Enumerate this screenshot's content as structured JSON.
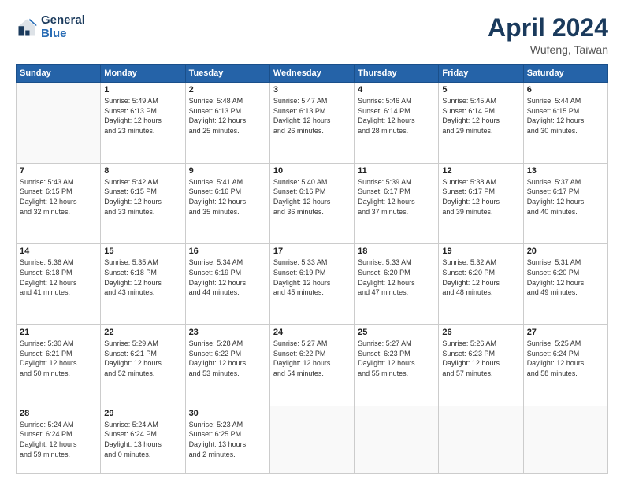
{
  "header": {
    "logo_line1": "General",
    "logo_line2": "Blue",
    "month": "April 2024",
    "location": "Wufeng, Taiwan"
  },
  "weekdays": [
    "Sunday",
    "Monday",
    "Tuesday",
    "Wednesday",
    "Thursday",
    "Friday",
    "Saturday"
  ],
  "weeks": [
    [
      {
        "day": "",
        "info": ""
      },
      {
        "day": "1",
        "info": "Sunrise: 5:49 AM\nSunset: 6:13 PM\nDaylight: 12 hours\nand 23 minutes."
      },
      {
        "day": "2",
        "info": "Sunrise: 5:48 AM\nSunset: 6:13 PM\nDaylight: 12 hours\nand 25 minutes."
      },
      {
        "day": "3",
        "info": "Sunrise: 5:47 AM\nSunset: 6:13 PM\nDaylight: 12 hours\nand 26 minutes."
      },
      {
        "day": "4",
        "info": "Sunrise: 5:46 AM\nSunset: 6:14 PM\nDaylight: 12 hours\nand 28 minutes."
      },
      {
        "day": "5",
        "info": "Sunrise: 5:45 AM\nSunset: 6:14 PM\nDaylight: 12 hours\nand 29 minutes."
      },
      {
        "day": "6",
        "info": "Sunrise: 5:44 AM\nSunset: 6:15 PM\nDaylight: 12 hours\nand 30 minutes."
      }
    ],
    [
      {
        "day": "7",
        "info": "Sunrise: 5:43 AM\nSunset: 6:15 PM\nDaylight: 12 hours\nand 32 minutes."
      },
      {
        "day": "8",
        "info": "Sunrise: 5:42 AM\nSunset: 6:15 PM\nDaylight: 12 hours\nand 33 minutes."
      },
      {
        "day": "9",
        "info": "Sunrise: 5:41 AM\nSunset: 6:16 PM\nDaylight: 12 hours\nand 35 minutes."
      },
      {
        "day": "10",
        "info": "Sunrise: 5:40 AM\nSunset: 6:16 PM\nDaylight: 12 hours\nand 36 minutes."
      },
      {
        "day": "11",
        "info": "Sunrise: 5:39 AM\nSunset: 6:17 PM\nDaylight: 12 hours\nand 37 minutes."
      },
      {
        "day": "12",
        "info": "Sunrise: 5:38 AM\nSunset: 6:17 PM\nDaylight: 12 hours\nand 39 minutes."
      },
      {
        "day": "13",
        "info": "Sunrise: 5:37 AM\nSunset: 6:17 PM\nDaylight: 12 hours\nand 40 minutes."
      }
    ],
    [
      {
        "day": "14",
        "info": "Sunrise: 5:36 AM\nSunset: 6:18 PM\nDaylight: 12 hours\nand 41 minutes."
      },
      {
        "day": "15",
        "info": "Sunrise: 5:35 AM\nSunset: 6:18 PM\nDaylight: 12 hours\nand 43 minutes."
      },
      {
        "day": "16",
        "info": "Sunrise: 5:34 AM\nSunset: 6:19 PM\nDaylight: 12 hours\nand 44 minutes."
      },
      {
        "day": "17",
        "info": "Sunrise: 5:33 AM\nSunset: 6:19 PM\nDaylight: 12 hours\nand 45 minutes."
      },
      {
        "day": "18",
        "info": "Sunrise: 5:33 AM\nSunset: 6:20 PM\nDaylight: 12 hours\nand 47 minutes."
      },
      {
        "day": "19",
        "info": "Sunrise: 5:32 AM\nSunset: 6:20 PM\nDaylight: 12 hours\nand 48 minutes."
      },
      {
        "day": "20",
        "info": "Sunrise: 5:31 AM\nSunset: 6:20 PM\nDaylight: 12 hours\nand 49 minutes."
      }
    ],
    [
      {
        "day": "21",
        "info": "Sunrise: 5:30 AM\nSunset: 6:21 PM\nDaylight: 12 hours\nand 50 minutes."
      },
      {
        "day": "22",
        "info": "Sunrise: 5:29 AM\nSunset: 6:21 PM\nDaylight: 12 hours\nand 52 minutes."
      },
      {
        "day": "23",
        "info": "Sunrise: 5:28 AM\nSunset: 6:22 PM\nDaylight: 12 hours\nand 53 minutes."
      },
      {
        "day": "24",
        "info": "Sunrise: 5:27 AM\nSunset: 6:22 PM\nDaylight: 12 hours\nand 54 minutes."
      },
      {
        "day": "25",
        "info": "Sunrise: 5:27 AM\nSunset: 6:23 PM\nDaylight: 12 hours\nand 55 minutes."
      },
      {
        "day": "26",
        "info": "Sunrise: 5:26 AM\nSunset: 6:23 PM\nDaylight: 12 hours\nand 57 minutes."
      },
      {
        "day": "27",
        "info": "Sunrise: 5:25 AM\nSunset: 6:24 PM\nDaylight: 12 hours\nand 58 minutes."
      }
    ],
    [
      {
        "day": "28",
        "info": "Sunrise: 5:24 AM\nSunset: 6:24 PM\nDaylight: 12 hours\nand 59 minutes."
      },
      {
        "day": "29",
        "info": "Sunrise: 5:24 AM\nSunset: 6:24 PM\nDaylight: 13 hours\nand 0 minutes."
      },
      {
        "day": "30",
        "info": "Sunrise: 5:23 AM\nSunset: 6:25 PM\nDaylight: 13 hours\nand 2 minutes."
      },
      {
        "day": "",
        "info": ""
      },
      {
        "day": "",
        "info": ""
      },
      {
        "day": "",
        "info": ""
      },
      {
        "day": "",
        "info": ""
      }
    ]
  ]
}
